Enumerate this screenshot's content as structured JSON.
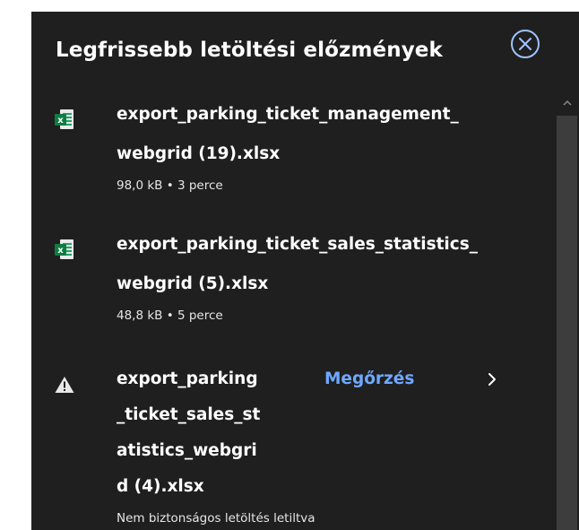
{
  "header": {
    "title": "Legfrissebb letöltési előzmények",
    "close_icon": "close-circle-icon"
  },
  "downloads": [
    {
      "icon": "excel-file-icon",
      "name_lines": [
        "export_parking_ticket_management_",
        "webgrid (19).xlsx"
      ],
      "meta": "98,0 kB • 3 perce"
    },
    {
      "icon": "excel-file-icon",
      "name_lines": [
        "export_parking_ticket_sales_statistics_",
        "webgrid (5).xlsx"
      ],
      "meta": "48,8 kB • 5 perce"
    },
    {
      "icon": "warning-icon",
      "name_lines": [
        "export_parking",
        "_ticket_sales_st",
        "atistics_webgri",
        "d (4).xlsx"
      ],
      "meta": "Nem biztonságos letöltés letiltva",
      "action_label": "Megőrzés",
      "action_icon": "chevron-right-icon"
    }
  ],
  "colors": {
    "panel_bg": "#1f1f1f",
    "text": "#ffffff",
    "link": "#6fa8ff",
    "scroll_thumb": "#3d3d3d",
    "excel_green": "#107c41"
  }
}
